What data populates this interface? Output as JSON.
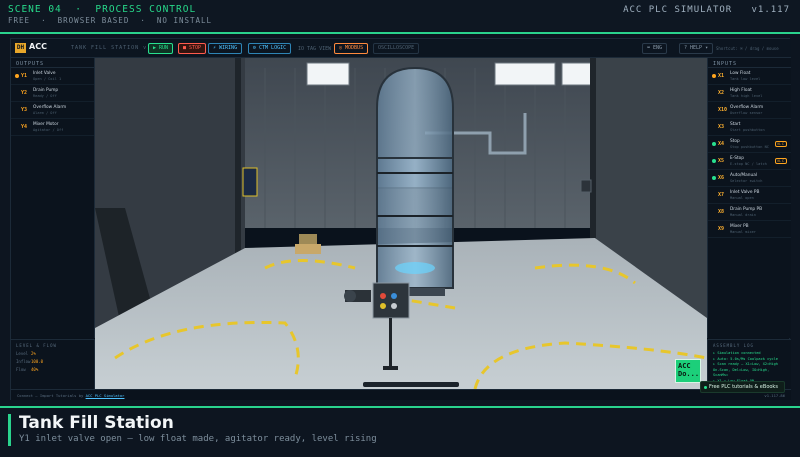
{
  "banner": {
    "scene": "SCENE 04",
    "section": "PROCESS CONTROL",
    "tags": [
      "FREE",
      "BROWSER BASED",
      "NO INSTALL"
    ],
    "product": "ACC PLC SIMULATOR",
    "version": "v1.117"
  },
  "toolbar": {
    "logo_badge": "DH",
    "logo_text": "ACC",
    "crumb": "TANK FILL STATION v1.102",
    "run": "▶ RUN",
    "stop": "■ STOP",
    "wiring": "⚡ WIRING",
    "ctm": "⚙ CTM LOGIC",
    "io": "IO TAG VIEW",
    "modbus": "◎ MODBUS",
    "oscilloscope": "OSCILLOSCOPE",
    "eng": "⌨ ENG",
    "help": "? HELP ▾",
    "hint": "Shortcut: ⌘ / drag / mouse"
  },
  "outputs": {
    "title": "OUTPUTS",
    "items": [
      {
        "tag": "Y1",
        "label": "Inlet Valve",
        "sub": "Open / Coil 1",
        "active": true
      },
      {
        "tag": "Y2",
        "label": "Drain Pump",
        "sub": "Ready / Off",
        "active": false
      },
      {
        "tag": "Y3",
        "label": "Overflow Alarm",
        "sub": "Alarm / Off",
        "active": false
      },
      {
        "tag": "Y4",
        "label": "Mixer Motor",
        "sub": "Agitator / Off",
        "active": false
      }
    ]
  },
  "inputs": {
    "title": "INPUTS",
    "items": [
      {
        "tag": "X1",
        "label": "Low Float",
        "sub": "Tank low level",
        "state": "orange",
        "pill": ""
      },
      {
        "tag": "X2",
        "label": "High Float",
        "sub": "Tank high level",
        "state": "none",
        "pill": ""
      },
      {
        "tag": "X10",
        "label": "Overflow Alarm",
        "sub": "Overflow sensor",
        "state": "none",
        "pill": ""
      },
      {
        "tag": "X3",
        "label": "Start",
        "sub": "Start pushbutton",
        "state": "none",
        "pill": ""
      },
      {
        "tag": "X4",
        "label": "Stop",
        "sub": "Stop pushbutton NC",
        "state": "green",
        "pill": "N.C"
      },
      {
        "tag": "X5",
        "label": "E-Stop",
        "sub": "E-stop NC / latch",
        "state": "green",
        "pill": "N.C"
      },
      {
        "tag": "X6",
        "label": "Auto/Manual",
        "sub": "Selector switch",
        "state": "green",
        "pill": ""
      },
      {
        "tag": "X7",
        "label": "Inlet Valve PB",
        "sub": "Manual open",
        "state": "none",
        "pill": ""
      },
      {
        "tag": "X8",
        "label": "Drain Pump PB",
        "sub": "Manual drain",
        "state": "none",
        "pill": ""
      },
      {
        "tag": "X9",
        "label": "Mixer PB",
        "sub": "Manual mixer",
        "state": "none",
        "pill": ""
      }
    ]
  },
  "level": {
    "title": "LEVEL & FLOW",
    "rows": [
      {
        "k": "Level",
        "v": "2%"
      },
      {
        "k": "Inflow",
        "v": "100.0"
      },
      {
        "k": "Flow",
        "v": "40%"
      }
    ]
  },
  "log": {
    "title": "ASSEMBLY LOG",
    "lines": [
      "▸ Simulation connected",
      "▸ Auto: 5.0s/Ms Coolpack cycle",
      "▸ Scan ready — X1=Low, X2=High",
      "On-Scan, Del=Low, IO=High, ScanMs=",
      "▸ X1 = Low Float ON"
    ]
  },
  "status": {
    "text": "Connect — Import Tutorials by",
    "link": "ACC PLC Simulator",
    "version": "v1.117.86"
  },
  "widget": {
    "text": "ACC\nDo..."
  },
  "promo": "Free PLC tutorials & eBooks",
  "footer": {
    "title": "Tank Fill Station",
    "desc": "Y1 inlet valve open — low float made, agitator ready, level rising"
  },
  "colors": {
    "accent": "#2ad38d",
    "output": "#ffa51f",
    "link": "#4fc3ff"
  }
}
